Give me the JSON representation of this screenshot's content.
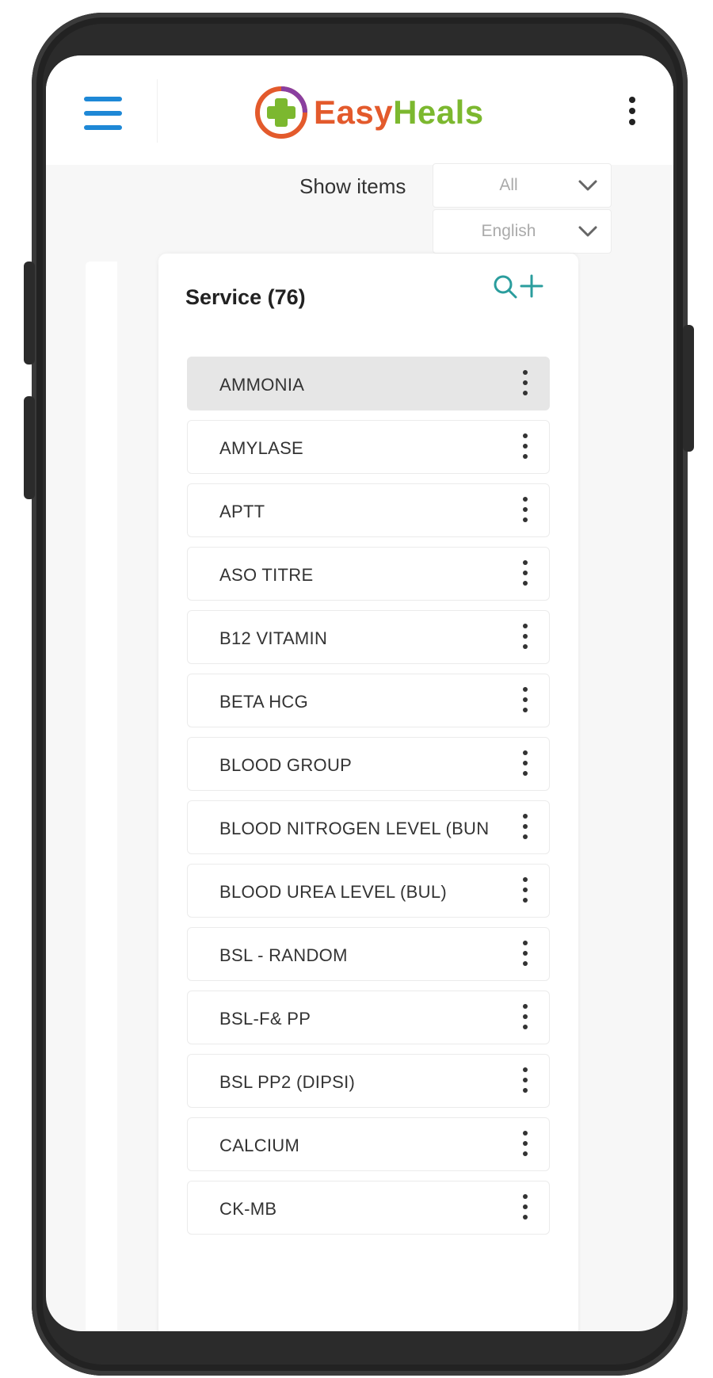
{
  "app": {
    "brand_part1": "Easy",
    "brand_part2": "Heals",
    "brand_color1": "#e35a2c",
    "brand_color2": "#7cb82f",
    "accent": "#1e88d6",
    "icon_accent": "#2a9d9d"
  },
  "header": {
    "menu_icon": "hamburger-menu-icon",
    "overflow_icon": "more-vertical-icon"
  },
  "filters": {
    "show_items_label": "Show items",
    "items_select_value": "All",
    "language_select_value": "English"
  },
  "service_panel": {
    "title": "Service (76)",
    "search_icon": "search-icon",
    "add_icon": "plus-icon",
    "items": [
      {
        "label": "AMMONIA",
        "selected": true
      },
      {
        "label": "AMYLASE"
      },
      {
        "label": "APTT"
      },
      {
        "label": "ASO TITRE"
      },
      {
        "label": "B12 VITAMIN"
      },
      {
        "label": "BETA HCG"
      },
      {
        "label": "BLOOD GROUP"
      },
      {
        "label": "BLOOD NITROGEN LEVEL (BUN"
      },
      {
        "label": "BLOOD UREA LEVEL (BUL)"
      },
      {
        "label": "BSL - RANDOM"
      },
      {
        "label": "BSL-F& PP"
      },
      {
        "label": "BSL PP2 (DIPSI)"
      },
      {
        "label": "CALCIUM"
      },
      {
        "label": "CK-MB"
      }
    ]
  }
}
